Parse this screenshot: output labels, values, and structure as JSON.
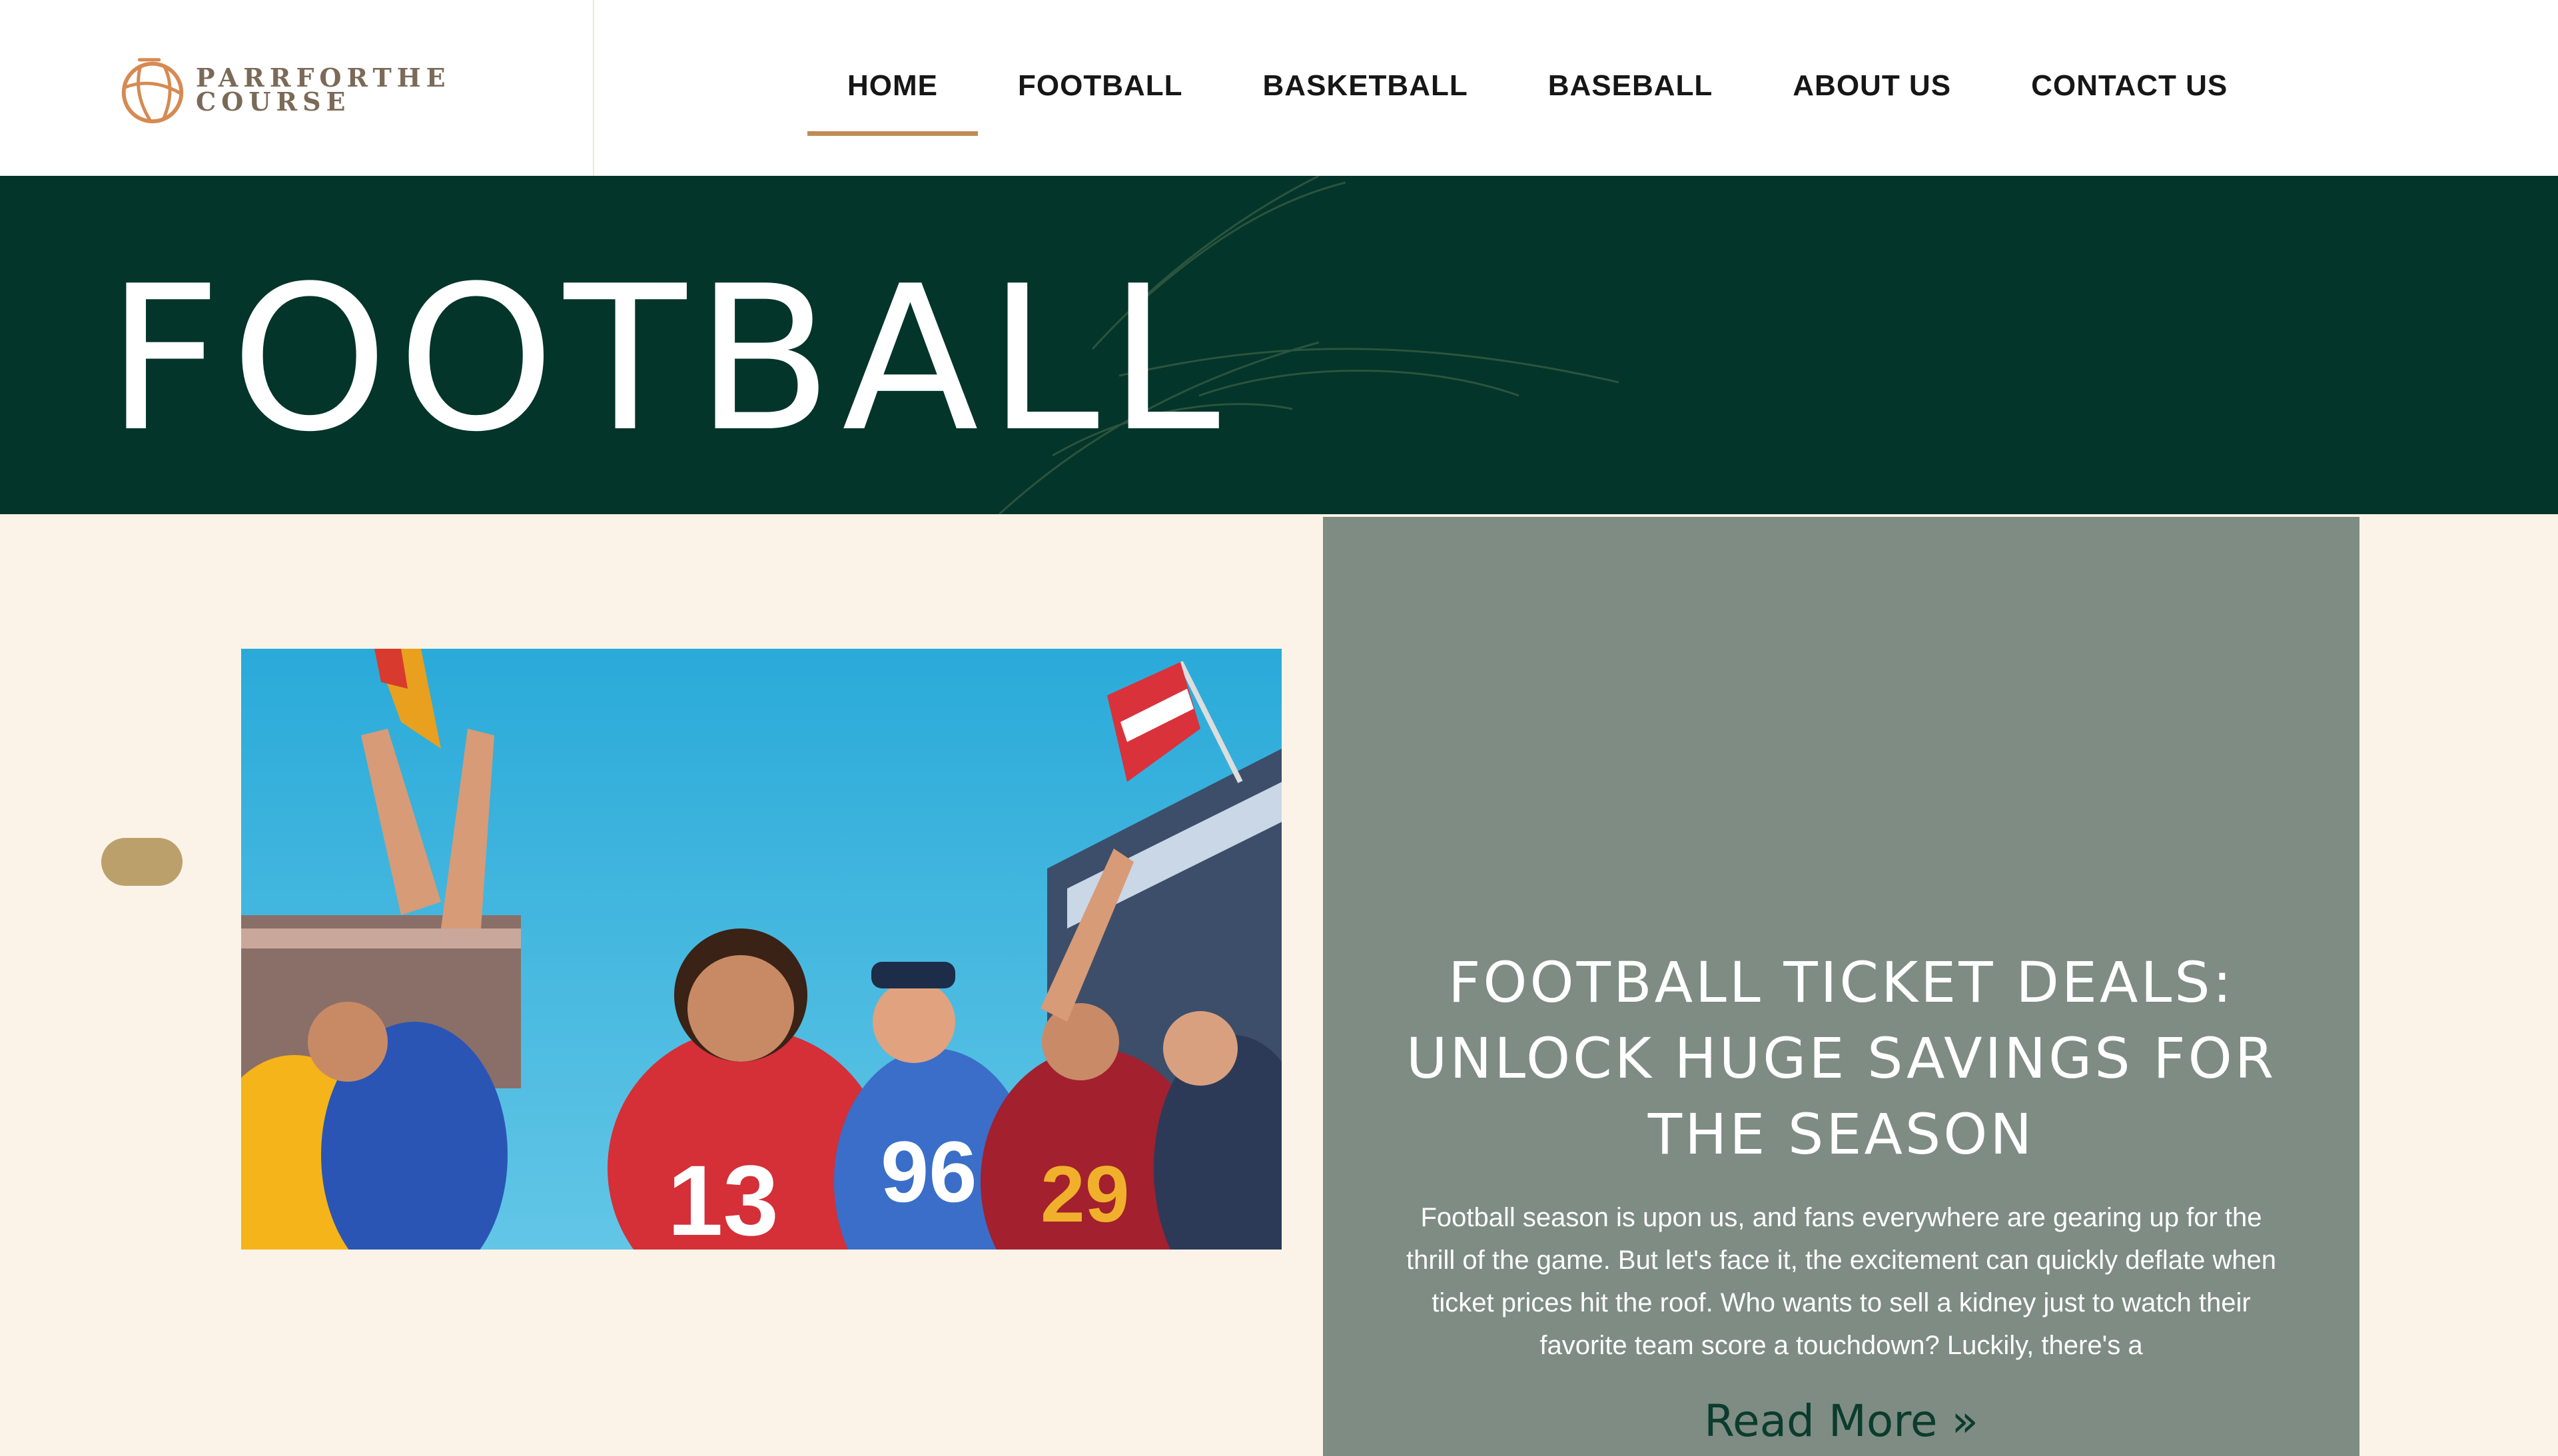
{
  "logo": {
    "line1": "PARRFORTHE",
    "line2": "COURSE"
  },
  "nav": {
    "items": [
      {
        "label": "HOME",
        "active": true
      },
      {
        "label": "FOOTBALL",
        "active": false
      },
      {
        "label": "BASKETBALL",
        "active": false
      },
      {
        "label": "BASEBALL",
        "active": false
      },
      {
        "label": "ABOUT US",
        "active": false
      },
      {
        "label": "CONTACT US",
        "active": false
      }
    ]
  },
  "hero": {
    "title": "FOOTBALL"
  },
  "post": {
    "title": "FOOTBALL TICKET DEALS: UNLOCK HUGE SAVINGS FOR THE SEASON",
    "excerpt": "Football season is upon us, and fans everywhere are gearing up for the thrill of the game. But let's face it, the excitement can quickly deflate when ticket prices hit the roof. Who wants to sell a kidney just to watch their favorite team score a touchdown? Luckily, there's a",
    "read_more": "Read More »",
    "image": {
      "jersey_numbers": [
        "13",
        "96",
        "29"
      ]
    }
  },
  "colors": {
    "hero_bg": "#03352a",
    "page_bg": "#fcf3e8",
    "card_bg": "#7e8c84",
    "accent": "#c08c55",
    "pager": "#bca06c"
  }
}
